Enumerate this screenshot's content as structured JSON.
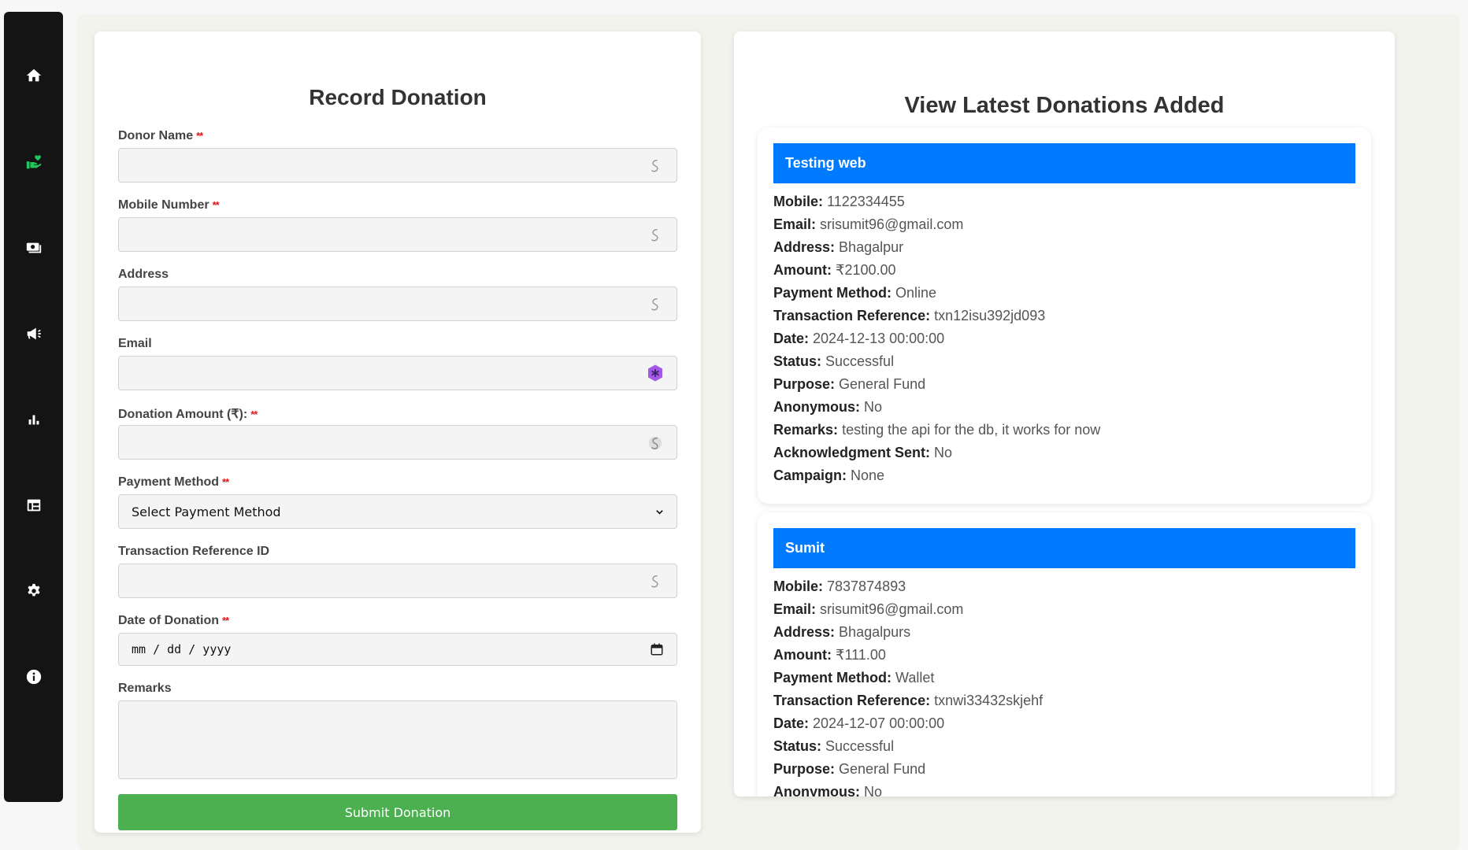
{
  "sidebar": {
    "items": [
      {
        "name": "home-icon",
        "color": "#ffffff"
      },
      {
        "name": "donate-hand-heart-icon",
        "color": "#22c55e"
      },
      {
        "name": "money-icon",
        "color": "#ffffff"
      },
      {
        "name": "megaphone-icon",
        "color": "#ffffff"
      },
      {
        "name": "bar-chart-icon",
        "color": "#ffffff"
      },
      {
        "name": "table-icon",
        "color": "#ffffff"
      },
      {
        "name": "gear-icon",
        "color": "#ffffff"
      },
      {
        "name": "info-icon",
        "color": "#ffffff"
      }
    ]
  },
  "form": {
    "title": "Record Donation",
    "required_mark": "**",
    "fields": {
      "donor_name": {
        "label": "Donor Name",
        "value": ""
      },
      "mobile": {
        "label": "Mobile Number",
        "value": ""
      },
      "address": {
        "label": "Address",
        "value": ""
      },
      "email": {
        "label": "Email",
        "value": ""
      },
      "amount": {
        "label": "Donation Amount (₹):",
        "value": ""
      },
      "payment_method": {
        "label": "Payment Method",
        "selected": "Select Payment Method"
      },
      "transaction_ref": {
        "label": "Transaction Reference ID",
        "value": ""
      },
      "date": {
        "label": "Date of Donation",
        "placeholder": "mm / dd / yyyy"
      },
      "remarks": {
        "label": "Remarks",
        "value": ""
      }
    },
    "submit_label": "Submit Donation",
    "submit_color": "#4caf50"
  },
  "list": {
    "title": "View Latest Donations Added",
    "header_color": "#007bff",
    "donations": [
      {
        "name": "Testing web",
        "fields": [
          {
            "k": "Mobile:",
            "v": "1122334455"
          },
          {
            "k": "Email:",
            "v": "srisumit96@gmail.com"
          },
          {
            "k": "Address:",
            "v": "Bhagalpur"
          },
          {
            "k": "Amount:",
            "v": "₹2100.00"
          },
          {
            "k": "Payment Method:",
            "v": "Online"
          },
          {
            "k": "Transaction Reference:",
            "v": "txn12isu392jd093"
          },
          {
            "k": "Date:",
            "v": "2024-12-13 00:00:00"
          },
          {
            "k": "Status:",
            "v": "Successful"
          },
          {
            "k": "Purpose:",
            "v": "General Fund"
          },
          {
            "k": "Anonymous:",
            "v": "No"
          },
          {
            "k": "Remarks:",
            "v": "testing the api for the db, it works for now"
          },
          {
            "k": "Acknowledgment Sent:",
            "v": "No"
          },
          {
            "k": "Campaign:",
            "v": "None"
          }
        ]
      },
      {
        "name": "Sumit",
        "fields": [
          {
            "k": "Mobile:",
            "v": "7837874893"
          },
          {
            "k": "Email:",
            "v": "srisumit96@gmail.com"
          },
          {
            "k": "Address:",
            "v": "Bhagalpurs"
          },
          {
            "k": "Amount:",
            "v": "₹111.00"
          },
          {
            "k": "Payment Method:",
            "v": "Wallet"
          },
          {
            "k": "Transaction Reference:",
            "v": "txnwi33432skjehf"
          },
          {
            "k": "Date:",
            "v": "2024-12-07 00:00:00"
          },
          {
            "k": "Status:",
            "v": "Successful"
          },
          {
            "k": "Purpose:",
            "v": "General Fund"
          },
          {
            "k": "Anonymous:",
            "v": "No"
          }
        ]
      }
    ]
  }
}
